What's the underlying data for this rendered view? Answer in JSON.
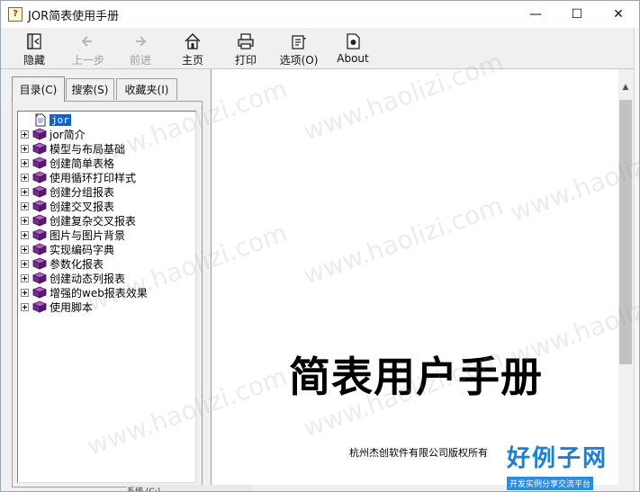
{
  "window": {
    "title": "JOR简表使用手册",
    "controls": {
      "minimize": "—",
      "maximize": "☐",
      "close": "✕"
    }
  },
  "toolbar": {
    "buttons": [
      {
        "label": "隐藏",
        "icon": "hide-icon",
        "enabled": true
      },
      {
        "label": "上一步",
        "icon": "back-arrow-icon",
        "enabled": false
      },
      {
        "label": "前进",
        "icon": "forward-arrow-icon",
        "enabled": false
      },
      {
        "label": "主页",
        "icon": "home-icon",
        "enabled": true
      },
      {
        "label": "打印",
        "icon": "printer-icon",
        "enabled": true
      },
      {
        "label": "选项(O)",
        "icon": "options-icon",
        "enabled": true
      },
      {
        "label": "About",
        "icon": "about-icon",
        "enabled": true
      }
    ]
  },
  "tabs": [
    {
      "label": "目录(C)",
      "active": true
    },
    {
      "label": "搜索(S)",
      "active": false
    },
    {
      "label": "收藏夹(I)",
      "active": false
    }
  ],
  "tree": {
    "items": [
      {
        "label": "jor",
        "icon": "document-icon",
        "selected": true,
        "expandable": false
      },
      {
        "label": "jor简介",
        "icon": "book-icon",
        "selected": false,
        "expandable": true
      },
      {
        "label": "模型与布局基础",
        "icon": "book-icon",
        "selected": false,
        "expandable": true
      },
      {
        "label": "创建简单表格",
        "icon": "book-icon",
        "selected": false,
        "expandable": true
      },
      {
        "label": "使用循环打印样式",
        "icon": "book-icon",
        "selected": false,
        "expandable": true
      },
      {
        "label": "创建分组报表",
        "icon": "book-icon",
        "selected": false,
        "expandable": true
      },
      {
        "label": "创建交叉报表",
        "icon": "book-icon",
        "selected": false,
        "expandable": true
      },
      {
        "label": "创建复杂交叉报表",
        "icon": "book-icon",
        "selected": false,
        "expandable": true
      },
      {
        "label": "图片与图片背景",
        "icon": "book-icon",
        "selected": false,
        "expandable": true
      },
      {
        "label": "实现编码字典",
        "icon": "book-icon",
        "selected": false,
        "expandable": true
      },
      {
        "label": "参数化报表",
        "icon": "book-icon",
        "selected": false,
        "expandable": true
      },
      {
        "label": "创建动态列报表",
        "icon": "book-icon",
        "selected": false,
        "expandable": true
      },
      {
        "label": "增强的web报表效果",
        "icon": "book-icon",
        "selected": false,
        "expandable": true
      },
      {
        "label": "使用脚本",
        "icon": "book-icon",
        "selected": false,
        "expandable": true
      }
    ]
  },
  "content": {
    "title": "简表用户手册",
    "copyright": "杭州杰创软件有限公司版权所有"
  },
  "watermark": {
    "text": "www.haolizi.com",
    "logo_main": "好例子网",
    "logo_sub": "开发实例分享交流平台"
  },
  "taskbar_peek": "系统 (C:)"
}
